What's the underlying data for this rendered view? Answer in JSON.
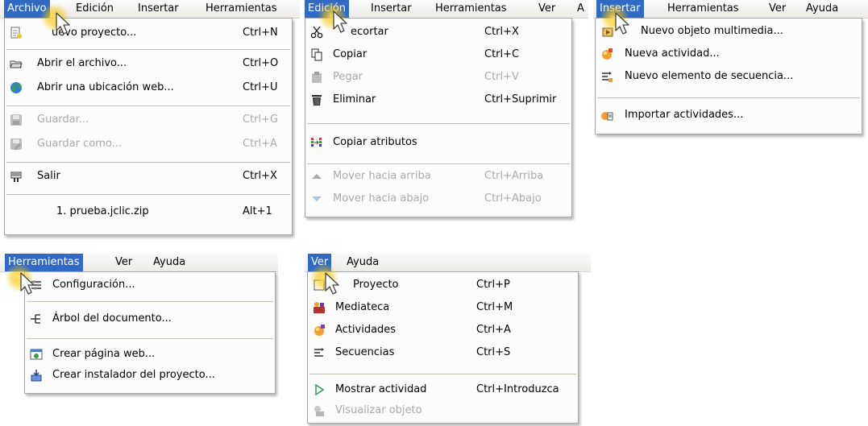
{
  "archivo_menu": {
    "menubar": [
      "Archivo",
      "Edición",
      "Insertar",
      "Herramientas"
    ],
    "items": [
      {
        "label": "uevo proyecto...",
        "shortcut": "Ctrl+N",
        "icon": "new-project-icon"
      },
      {
        "label": "Abrir el archivo...",
        "shortcut": "Ctrl+O",
        "icon": "open-folder-icon"
      },
      {
        "label": "Abrir una ubicación web...",
        "shortcut": "Ctrl+U",
        "icon": "globe-icon"
      },
      {
        "label": "Guardar...",
        "shortcut": "Ctrl+G",
        "icon": "save-icon",
        "disabled": true
      },
      {
        "label": "Guardar como...",
        "shortcut": "Ctrl+A",
        "icon": "save-as-icon",
        "disabled": true
      },
      {
        "label": "Salir",
        "shortcut": "Ctrl+X",
        "icon": "exit-icon"
      },
      {
        "label": "1. prueba.jclic.zip",
        "shortcut": "Alt+1"
      }
    ]
  },
  "edicion_menu": {
    "menubar": [
      "Edición",
      "Insertar",
      "Herramientas",
      "Ver",
      "A"
    ],
    "items": [
      {
        "label": "ecortar",
        "shortcut": "Ctrl+X",
        "icon": "scissors-icon"
      },
      {
        "label": "Copiar",
        "shortcut": "Ctrl+C",
        "icon": "copy-icon"
      },
      {
        "label": "Pegar",
        "shortcut": "Ctrl+V",
        "icon": "paste-icon",
        "disabled": true
      },
      {
        "label": "Eliminar",
        "shortcut": "Ctrl+Suprimir",
        "icon": "trash-icon"
      },
      {
        "label": "Copiar atributos",
        "icon": "copy-attributes-icon"
      },
      {
        "label": "Mover hacia arriba",
        "shortcut": "Ctrl+Arriba",
        "icon": "arrow-up-icon",
        "disabled": true
      },
      {
        "label": "Mover hacia abajo",
        "shortcut": "Ctrl+Abajo",
        "icon": "arrow-down-icon",
        "disabled": true
      }
    ]
  },
  "insertar_menu": {
    "menubar": [
      "Insertar",
      "Herramientas",
      "Ver",
      "Ayuda"
    ],
    "items": [
      {
        "label": "Nuevo objeto multimedia...",
        "icon": "media-object-icon"
      },
      {
        "label": "Nueva actividad...",
        "icon": "activity-icon"
      },
      {
        "label": "Nuevo elemento de secuencia...",
        "icon": "sequence-element-icon"
      },
      {
        "label": "Importar actividades...",
        "icon": "import-icon"
      }
    ]
  },
  "herramientas_menu": {
    "menubar": [
      "Herramientas",
      "Ver",
      "Ayuda"
    ],
    "items": [
      {
        "label": "Configuración...",
        "icon": "settings-icon"
      },
      {
        "label": "Árbol del documento...",
        "icon": "document-tree-icon"
      },
      {
        "label": "Crear página web...",
        "icon": "web-page-icon"
      },
      {
        "label": "Crear instalador del proyecto...",
        "icon": "installer-icon"
      }
    ]
  },
  "ver_menu": {
    "menubar": [
      "Ver",
      "Ayuda"
    ],
    "items": [
      {
        "label": "Proyecto",
        "shortcut": "Ctrl+P",
        "icon": "project-icon"
      },
      {
        "label": "Mediateca",
        "shortcut": "Ctrl+M",
        "icon": "media-library-icon"
      },
      {
        "label": "Actividades",
        "shortcut": "Ctrl+A",
        "icon": "activities-icon"
      },
      {
        "label": "Secuencias",
        "shortcut": "Ctrl+S",
        "icon": "sequences-icon"
      },
      {
        "label": "Mostrar actividad",
        "shortcut": "Ctrl+Introduzca",
        "icon": "play-icon"
      },
      {
        "label": "Visualizar objeto",
        "icon": "view-object-icon",
        "disabled": true
      }
    ]
  },
  "colors": {
    "highlight": "#316ac5",
    "disabled_text": "#a9a9a9",
    "cursor_glow": "#f5c400"
  }
}
